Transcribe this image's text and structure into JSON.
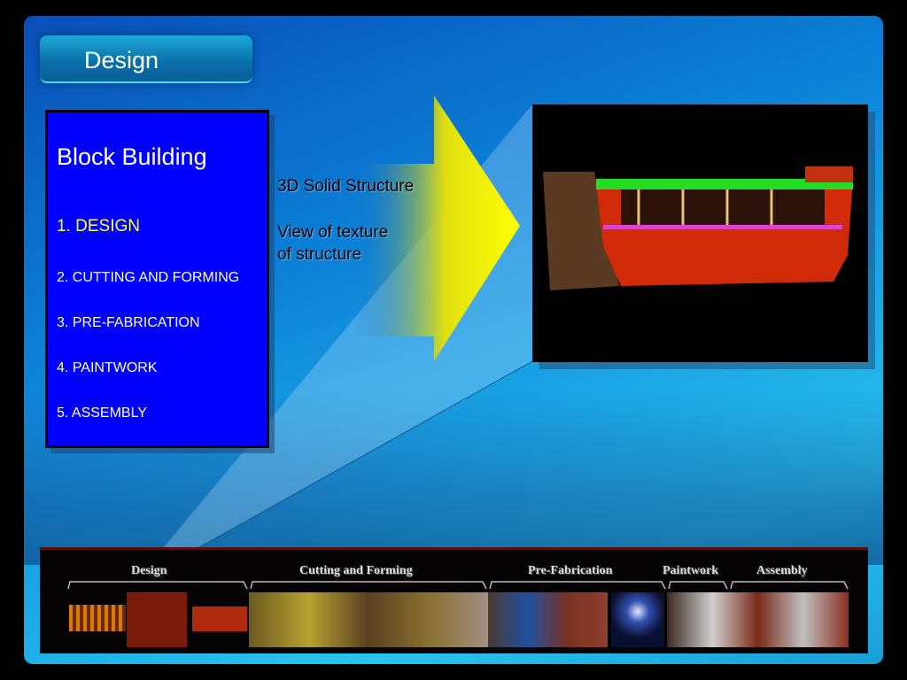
{
  "slide_title": "Design",
  "menu": {
    "heading": "Block Building",
    "items": [
      "1. DESIGN",
      "2. CUTTING  AND FORMING",
      "3. PRE-FABRICATION",
      "4. PAINTWORK",
      "5. ASSEMBLY"
    ],
    "active_color": "#ffff33"
  },
  "caption": {
    "line1": "3D Solid Structure",
    "line2": "View of texture",
    "line3": "of structure"
  },
  "strip": {
    "stages": [
      "Design",
      "Cutting and Forming",
      "Pre-Fabrication",
      "Paintwork",
      "Assembly"
    ]
  },
  "colors": {
    "menu_bg": "#0000ff",
    "arrow": "#ffff00"
  }
}
